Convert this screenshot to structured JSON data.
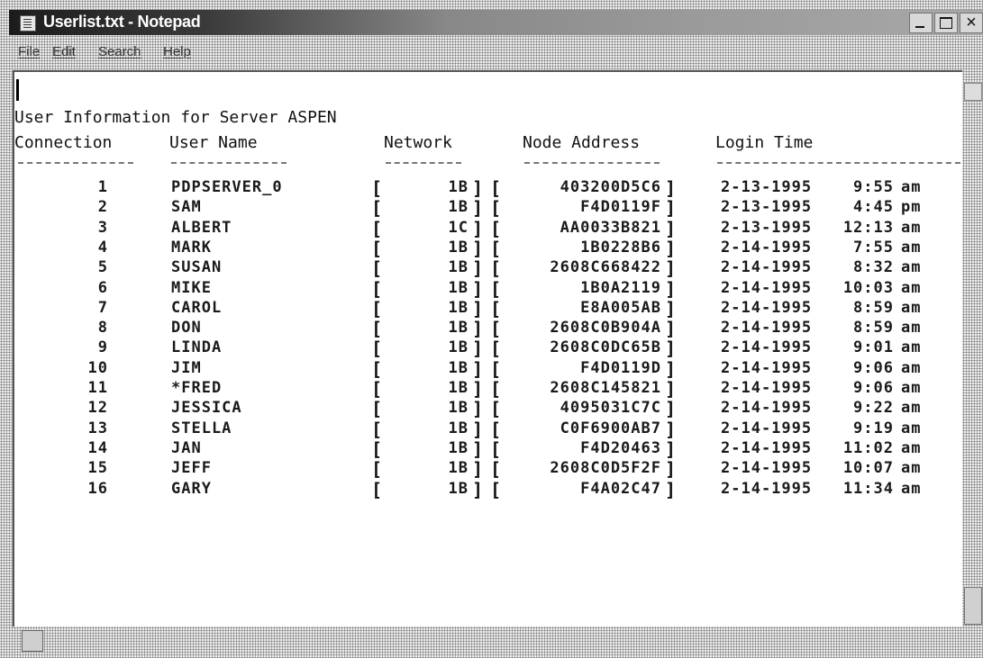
{
  "window": {
    "title": "Userlist.txt - Notepad",
    "close_glyph": "×"
  },
  "menu": [
    {
      "label": "File"
    },
    {
      "label": "Edit"
    },
    {
      "label": "Search"
    },
    {
      "label": "Help"
    }
  ],
  "document": {
    "heading": "User Information for Server ASPEN",
    "columns": {
      "connection": "Connection",
      "user": "User Name",
      "network": "Network",
      "node": "Node Address",
      "login": "Login Time"
    },
    "rows": [
      {
        "conn": "1",
        "user": "PDPSERVER_0",
        "network": "1B",
        "node": "403200D5C6",
        "date": "2-13-1995",
        "time": "9:55",
        "ampm": "am"
      },
      {
        "conn": "2",
        "user": "SAM",
        "network": "1B",
        "node": "F4D0119F",
        "date": "2-13-1995",
        "time": "4:45",
        "ampm": "pm"
      },
      {
        "conn": "3",
        "user": "ALBERT",
        "network": "1C",
        "node": "AA0033B821",
        "date": "2-13-1995",
        "time": "12:13",
        "ampm": "am"
      },
      {
        "conn": "4",
        "user": "MARK",
        "network": "1B",
        "node": "1B0228B6",
        "date": "2-14-1995",
        "time": "7:55",
        "ampm": "am"
      },
      {
        "conn": "5",
        "user": "SUSAN",
        "network": "1B",
        "node": "2608C668422",
        "date": "2-14-1995",
        "time": "8:32",
        "ampm": "am"
      },
      {
        "conn": "6",
        "user": "MIKE",
        "network": "1B",
        "node": "1B0A2119",
        "date": "2-14-1995",
        "time": "10:03",
        "ampm": "am"
      },
      {
        "conn": "7",
        "user": "CAROL",
        "network": "1B",
        "node": "E8A005AB",
        "date": "2-14-1995",
        "time": "8:59",
        "ampm": "am"
      },
      {
        "conn": "8",
        "user": "DON",
        "network": "1B",
        "node": "2608C0B904A",
        "date": "2-14-1995",
        "time": "8:59",
        "ampm": "am"
      },
      {
        "conn": "9",
        "user": "LINDA",
        "network": "1B",
        "node": "2608C0DC65B",
        "date": "2-14-1995",
        "time": "9:01",
        "ampm": "am"
      },
      {
        "conn": "10",
        "user": "JIM",
        "network": "1B",
        "node": "F4D0119D",
        "date": "2-14-1995",
        "time": "9:06",
        "ampm": "am"
      },
      {
        "conn": "11",
        "user": "*FRED",
        "network": "1B",
        "node": "2608C145821",
        "date": "2-14-1995",
        "time": "9:06",
        "ampm": "am"
      },
      {
        "conn": "12",
        "user": "JESSICA",
        "network": "1B",
        "node": "4095031C7C",
        "date": "2-14-1995",
        "time": "9:22",
        "ampm": "am"
      },
      {
        "conn": "13",
        "user": "STELLA",
        "network": "1B",
        "node": "C0F6900AB7",
        "date": "2-14-1995",
        "time": "9:19",
        "ampm": "am"
      },
      {
        "conn": "14",
        "user": "JAN",
        "network": "1B",
        "node": "F4D20463",
        "date": "2-14-1995",
        "time": "11:02",
        "ampm": "am"
      },
      {
        "conn": "15",
        "user": "JEFF",
        "network": "1B",
        "node": "2608C0D5F2F",
        "date": "2-14-1995",
        "time": "10:07",
        "ampm": "am"
      },
      {
        "conn": "16",
        "user": "GARY",
        "network": "1B",
        "node": "F4A02C47",
        "date": "2-14-1995",
        "time": "11:34",
        "ampm": "am"
      }
    ]
  }
}
